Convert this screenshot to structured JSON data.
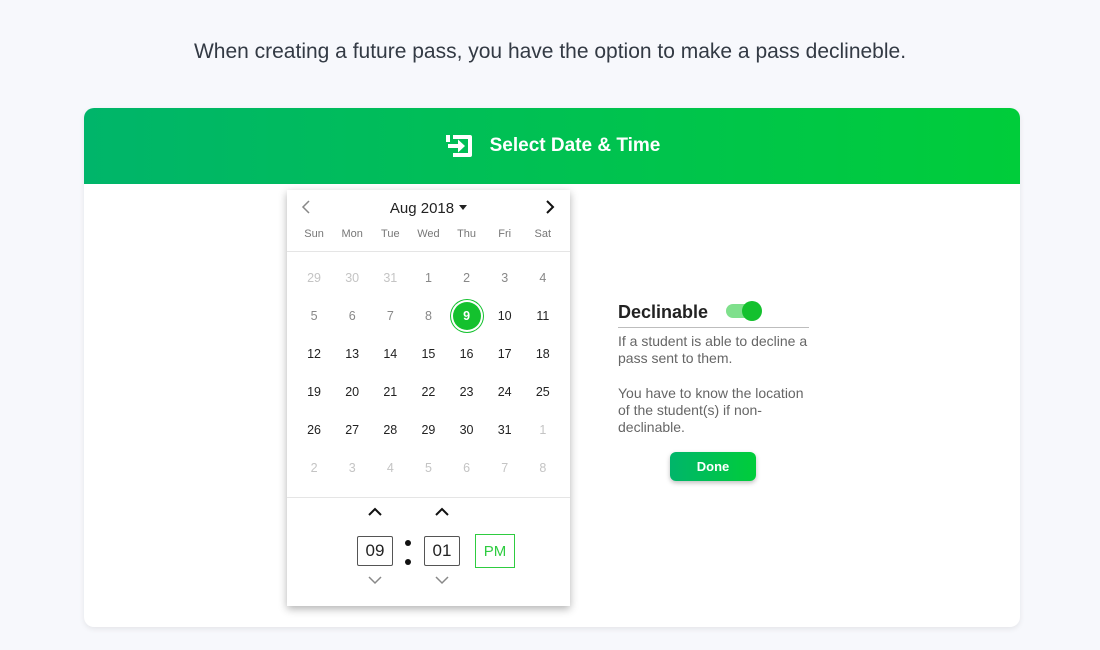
{
  "intro_text": "When creating a future pass, you have the option to make a pass declineble.",
  "header": {
    "icon": "pass-enter-icon",
    "title": "Select Date & Time"
  },
  "calendar": {
    "month_label": "Aug 2018",
    "weekdays": [
      "Sun",
      "Mon",
      "Tue",
      "Wed",
      "Thu",
      "Fri",
      "Sat"
    ],
    "weeks": [
      [
        {
          "d": "29",
          "s": "muted"
        },
        {
          "d": "30",
          "s": "muted"
        },
        {
          "d": "31",
          "s": "muted"
        },
        {
          "d": "1",
          "s": "dim"
        },
        {
          "d": "2",
          "s": "dim"
        },
        {
          "d": "3",
          "s": "dim"
        },
        {
          "d": "4",
          "s": "dim"
        }
      ],
      [
        {
          "d": "5",
          "s": "dim"
        },
        {
          "d": "6",
          "s": "dim"
        },
        {
          "d": "7",
          "s": "dim"
        },
        {
          "d": "8",
          "s": "dim"
        },
        {
          "d": "9",
          "s": "selected"
        },
        {
          "d": "10",
          "s": ""
        },
        {
          "d": "11",
          "s": ""
        }
      ],
      [
        {
          "d": "12",
          "s": ""
        },
        {
          "d": "13",
          "s": ""
        },
        {
          "d": "14",
          "s": ""
        },
        {
          "d": "15",
          "s": ""
        },
        {
          "d": "16",
          "s": ""
        },
        {
          "d": "17",
          "s": ""
        },
        {
          "d": "18",
          "s": ""
        }
      ],
      [
        {
          "d": "19",
          "s": ""
        },
        {
          "d": "20",
          "s": ""
        },
        {
          "d": "21",
          "s": ""
        },
        {
          "d": "22",
          "s": ""
        },
        {
          "d": "23",
          "s": ""
        },
        {
          "d": "24",
          "s": ""
        },
        {
          "d": "25",
          "s": ""
        }
      ],
      [
        {
          "d": "26",
          "s": ""
        },
        {
          "d": "27",
          "s": ""
        },
        {
          "d": "28",
          "s": ""
        },
        {
          "d": "29",
          "s": ""
        },
        {
          "d": "30",
          "s": ""
        },
        {
          "d": "31",
          "s": ""
        },
        {
          "d": "1",
          "s": "muted"
        }
      ],
      [
        {
          "d": "2",
          "s": "muted"
        },
        {
          "d": "3",
          "s": "muted"
        },
        {
          "d": "4",
          "s": "muted"
        },
        {
          "d": "5",
          "s": "muted"
        },
        {
          "d": "6",
          "s": "muted"
        },
        {
          "d": "7",
          "s": "muted"
        },
        {
          "d": "8",
          "s": "muted"
        }
      ]
    ],
    "selected_day": "9"
  },
  "time": {
    "hour": "09",
    "minute": "01",
    "period": "PM"
  },
  "declinable": {
    "title": "Declinable",
    "enabled": true,
    "text1": "If a student is able to decline a pass sent to them.",
    "text2": "You have to know the location of the student(s) if non-declinable."
  },
  "done_label": "Done",
  "colors": {
    "accent": "#14c12e",
    "header_gradient_start": "#00b56a",
    "header_gradient_end": "#00cd3a"
  }
}
